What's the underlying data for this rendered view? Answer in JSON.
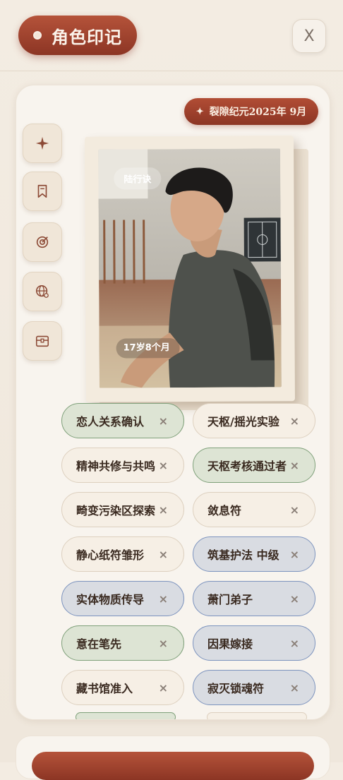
{
  "header": {
    "title": "角色印记",
    "close_label": "X"
  },
  "era": {
    "label": "裂隙纪元2025年 9月",
    "icon": "sparkle-icon"
  },
  "sidebar": {
    "items": [
      {
        "icon": "sparkle-icon"
      },
      {
        "icon": "bookmark-icon"
      },
      {
        "icon": "target-icon"
      },
      {
        "icon": "globe-icon"
      },
      {
        "icon": "chest-icon"
      }
    ]
  },
  "character": {
    "name": "陆行诀",
    "age": "17岁8个月"
  },
  "tags": [
    {
      "label": "恋人关系确认",
      "style": "green"
    },
    {
      "label": "天枢/摇光实验",
      "style": "cream"
    },
    {
      "label": "精神共修与共鸣",
      "style": "cream"
    },
    {
      "label": "天枢考核通过者",
      "style": "green"
    },
    {
      "label": "畸变污染区探索",
      "style": "cream"
    },
    {
      "label": "敛息符",
      "style": "cream"
    },
    {
      "label": "静心纸符雏形",
      "style": "cream"
    },
    {
      "label": "筑基护法 中级",
      "style": "blue"
    },
    {
      "label": "实体物质传导",
      "style": "blue"
    },
    {
      "label": "萧门弟子",
      "style": "blue"
    },
    {
      "label": "意在笔先",
      "style": "green"
    },
    {
      "label": "因果嫁接",
      "style": "blue"
    },
    {
      "label": "藏书馆准入",
      "style": "cream"
    },
    {
      "label": "寂灭锁魂符",
      "style": "blue"
    }
  ],
  "chip_remove": "×",
  "colors": {
    "accent": "#9c3f2a",
    "green_border": "#7fa07a",
    "blue_border": "#7c93be"
  }
}
